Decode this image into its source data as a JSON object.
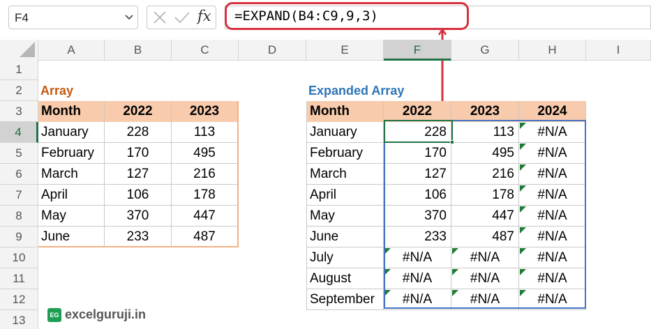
{
  "name_box": {
    "value": "F4"
  },
  "formula_bar": {
    "formula": "=EXPAND(B4:C9,9,3)"
  },
  "columns": [
    "A",
    "B",
    "C",
    "D",
    "E",
    "F",
    "G",
    "H",
    "I"
  ],
  "active_column": "F",
  "rows": [
    "1",
    "2",
    "3",
    "4",
    "5",
    "6",
    "7",
    "8",
    "9",
    "10",
    "11",
    "12",
    "13"
  ],
  "active_row": "4",
  "array_table": {
    "title": "Array",
    "title_color": "#c55a11",
    "headers": [
      "Month",
      "2022",
      "2023"
    ],
    "rows": [
      [
        "January",
        "228",
        "113"
      ],
      [
        "February",
        "170",
        "495"
      ],
      [
        "March",
        "127",
        "216"
      ],
      [
        "April",
        "106",
        "178"
      ],
      [
        "May",
        "370",
        "447"
      ],
      [
        "June",
        "233",
        "487"
      ]
    ]
  },
  "expanded_table": {
    "title": "Expanded Array",
    "title_color": "#2e75b6",
    "headers": [
      "Month",
      "2022",
      "2023",
      "2024"
    ],
    "rows": [
      [
        "January",
        "228",
        "113",
        "#N/A"
      ],
      [
        "February",
        "170",
        "495",
        "#N/A"
      ],
      [
        "March",
        "127",
        "216",
        "#N/A"
      ],
      [
        "April",
        "106",
        "178",
        "#N/A"
      ],
      [
        "May",
        "370",
        "447",
        "#N/A"
      ],
      [
        "June",
        "233",
        "487",
        "#N/A"
      ],
      [
        "July",
        "#N/A",
        "#N/A",
        "#N/A"
      ],
      [
        "August",
        "#N/A",
        "#N/A",
        "#N/A"
      ],
      [
        "September",
        "#N/A",
        "#N/A",
        "#N/A"
      ]
    ]
  },
  "watermark": {
    "badge": "EG",
    "text": "excelguruji.in"
  },
  "colors": {
    "header_fill": "#f8cbad",
    "spill_border": "#4472c4",
    "active_cell": "#217346",
    "highlight": "#d6313d",
    "error_indicator": "#1e7b34"
  },
  "icons": [
    "chevron-down-icon",
    "cancel-icon",
    "enter-icon",
    "fx-icon",
    "select-all-icon"
  ]
}
